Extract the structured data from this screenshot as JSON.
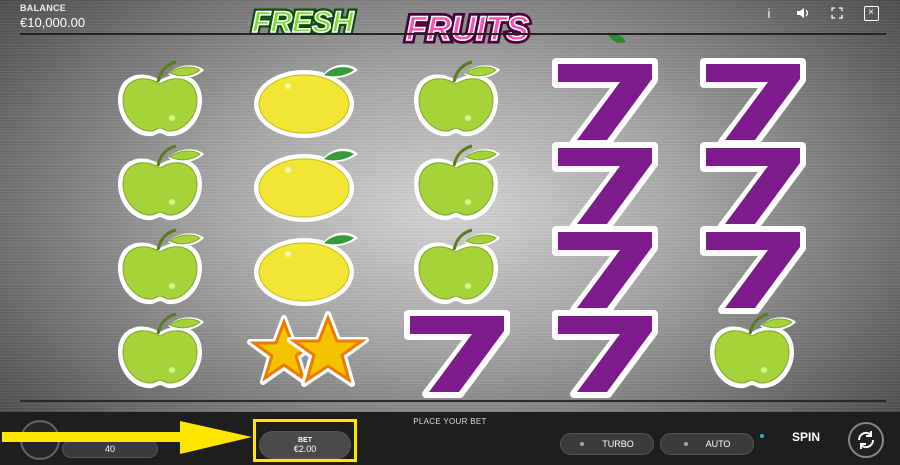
{
  "balance": {
    "label": "BALANCE",
    "value": "€10,000.00"
  },
  "logo": {
    "word1": "FRESH",
    "word2": "FRUITS"
  },
  "top_icons": [
    "info-icon",
    "sound-icon",
    "fullscreen-icon",
    "close-icon"
  ],
  "reels": [
    [
      "apple",
      "apple",
      "apple",
      "apple"
    ],
    [
      "lemon",
      "lemon",
      "lemon",
      "star"
    ],
    [
      "apple",
      "apple",
      "apple",
      "seven"
    ],
    [
      "seven",
      "seven",
      "seven",
      "seven"
    ],
    [
      "seven",
      "seven",
      "seven",
      "apple"
    ]
  ],
  "bottom": {
    "place_bet": "PLACE YOUR BET",
    "lines_value": "40",
    "bet_label": "BET",
    "bet_value": "€2.00",
    "turbo": "TURBO",
    "auto": "AUTO",
    "spin": "SPIN"
  },
  "colors": {
    "apple": "#a6d23a",
    "lemon": "#f2e534",
    "seven": "#7d1b8c",
    "star": "#f5c400",
    "highlight": "#ffe600"
  }
}
